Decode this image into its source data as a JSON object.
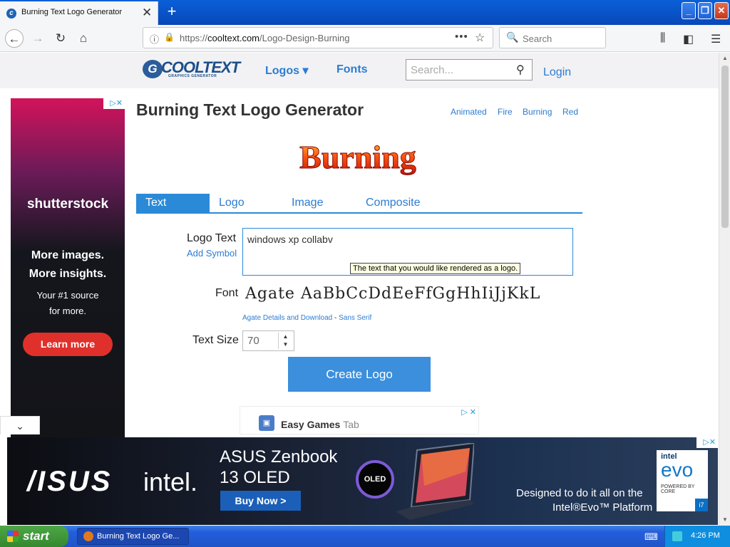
{
  "browser": {
    "tab_title": "Burning Text Logo Generator",
    "url_prefix": "https://",
    "url_domain": "cooltext.com",
    "url_path": "/Logo-Design-Burning",
    "search_placeholder": "Search"
  },
  "site": {
    "logo_word": "COOLTEXT",
    "logo_sub": "GRAPHICS GENERATOR",
    "nav_logos": "Logos ▾",
    "nav_fonts": "Fonts",
    "search_placeholder": "Search...",
    "login": "Login"
  },
  "page": {
    "title": "Burning Text Logo Generator",
    "tags": [
      "Animated",
      "Fire",
      "Burning",
      "Red"
    ],
    "preview_word": "Burning",
    "tabs": [
      "Text",
      "Logo",
      "Image",
      "Composite"
    ],
    "logo_text_label": "Logo Text",
    "add_symbol": "Add Symbol",
    "logo_text_value": "windows xp collabv",
    "tooltip": "The text that you would like rendered as a logo.",
    "font_label": "Font",
    "font_sample": "Agate AaBbCcDdEeFfGgHhIiJjKkL",
    "font_details_link": "Agate Details and Download",
    "font_sep": " - ",
    "font_category_link": "Sans Serif",
    "text_size_label": "Text Size",
    "text_size_value": "70",
    "create_button": "Create Logo"
  },
  "ads": {
    "left_brand": "shutterstock",
    "left_headline_1": "More images.",
    "left_headline_2": "More insights.",
    "left_body_1": "Your #1 source",
    "left_body_2": "for more.",
    "left_cta": "Learn more",
    "mini_title": "Easy Games",
    "mini_sub": "Tab",
    "bottom_brand": "/ISUS",
    "bottom_intel": "intel.",
    "bottom_line1": "ASUS Zenbook",
    "bottom_line2": "13 OLED",
    "bottom_cta": "Buy Now >",
    "bottom_oled": "OLED",
    "bottom_tag1": "Designed to do it all on the",
    "bottom_tag2": "Intel®Evo™ Platform",
    "evo_intel": "intel",
    "evo_word": "evo",
    "evo_small": "POWERED BY CORE",
    "evo_i7": "i7"
  },
  "taskbar": {
    "start": "start",
    "task_item": "Burning Text Logo Ge...",
    "clock": "4:26 PM"
  }
}
